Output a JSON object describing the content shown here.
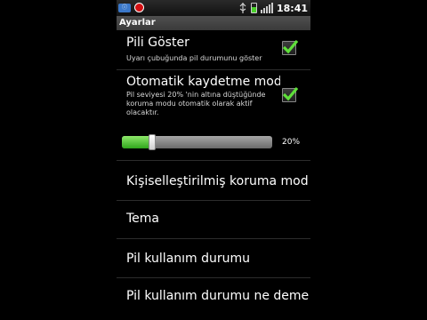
{
  "status_bar": {
    "time": "18:41",
    "icons": [
      "notification-icon",
      "record-icon",
      "usb-icon",
      "battery-icon",
      "signal-icon"
    ],
    "battery_level": 0.5
  },
  "title_bar": {
    "title": "Ayarlar"
  },
  "preferences": [
    {
      "title": "Pili Göster",
      "summary": "Uyarı çubuğunda pil durumunu göster",
      "checked": true
    },
    {
      "title": "Otomatik kaydetme modu",
      "summary": "Pil seviyesi 20% 'nin altına düştüğünde koruma modu otomatik olarak aktif olacaktır.",
      "checked": true
    },
    {
      "title": "Kişiselleştirilmiş koruma modu"
    },
    {
      "title": "Tema"
    },
    {
      "title": "Pil kullanım durumu"
    },
    {
      "title": "Pil kullanım durumu ne demek"
    }
  ],
  "threshold_slider": {
    "value_label": "20%",
    "value_fraction": 0.2
  },
  "colors": {
    "accent_green": "#4ad02b",
    "background": "#000000",
    "divider": "#2c2c2c"
  }
}
